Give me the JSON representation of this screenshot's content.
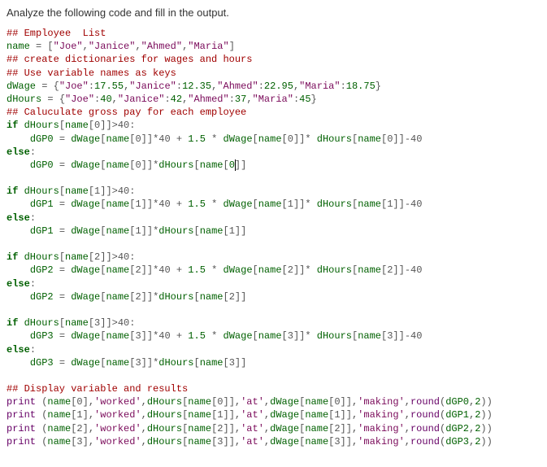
{
  "prompt_text": "Analyze the following code and fill in the output.",
  "code": {
    "c1": "## Employee  List",
    "l_name_lhs": "name",
    "l_name_eq": " = ",
    "l_name_open": "[",
    "s_joe": "\"Joe\"",
    "s_janice": "\"Janice\"",
    "s_ahmed": "\"Ahmed\"",
    "s_maria": "\"Maria\"",
    "comma": ",",
    "l_name_close": "]",
    "c2": "## create dictionaries for wages and hours",
    "c3": "## Use variable names as keys",
    "dwage_lhs": "dWage",
    "dwage_eq": " = ",
    "brace_open": "{",
    "brace_close": "}",
    "colon": ":",
    "w_joe": "17.55",
    "w_janice": "12.35",
    "w_ahmed": "22.95",
    "w_maria": "18.75",
    "dhours_lhs": "dHours",
    "h_joe": "40",
    "h_janice": "42",
    "h_ahmed": "37",
    "h_maria": "45",
    "c4": "## Caluculate gross pay for each employee",
    "kw_if": "if",
    "kw_else": "else",
    "cond_tail": ">40:",
    "else_tail": ":",
    "dHours": "dHours",
    "dWage": "dWage",
    "name_ref": "name",
    "idx0": "[0]",
    "idx1": "[1]",
    "idx2": "[2]",
    "idx3": "[3]",
    "forty": "*40",
    "plus": " + ",
    "oneptfive": "1.5",
    "times": " * ",
    "minus40": "-40",
    "star": "*",
    "eq": " = ",
    "dGP0": "dGP0",
    "dGP1": "dGP1",
    "dGP2": "dGP2",
    "dGP3": "dGP3",
    "c5": "## Display variable and results",
    "print": "print",
    "round": "round",
    "space": " ",
    "paren_open": "(",
    "paren_close": ")",
    "br_open": "[",
    "br_close": "]",
    "s_worked": "'worked'",
    "s_at": "'at'",
    "s_making": "'making'",
    "two": "2",
    "close2": "))"
  },
  "chart_data": {
    "type": "table",
    "description": "Python source defining employee list, wage & hours dicts, computing gross pay with overtime, then printing results.",
    "employees": [
      "Joe",
      "Janice",
      "Ahmed",
      "Maria"
    ],
    "wages": {
      "Joe": 17.55,
      "Janice": 12.35,
      "Ahmed": 22.95,
      "Maria": 18.75
    },
    "hours": {
      "Joe": 40,
      "Janice": 42,
      "Ahmed": 37,
      "Maria": 45
    },
    "overtime_threshold": 40,
    "overtime_multiplier": 1.5
  }
}
